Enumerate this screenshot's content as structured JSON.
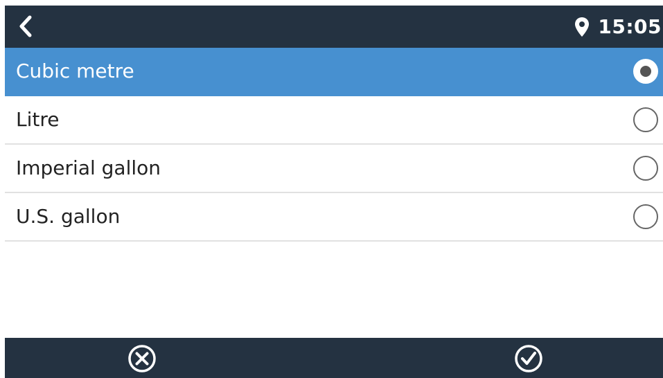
{
  "header": {
    "back_icon": "chevron-left-icon",
    "location_icon": "map-pin-icon",
    "time": "15:05"
  },
  "options": [
    {
      "label": "Cubic metre",
      "selected": true
    },
    {
      "label": "Litre",
      "selected": false
    },
    {
      "label": "Imperial gallon",
      "selected": false
    },
    {
      "label": "U.S. gallon",
      "selected": false
    }
  ],
  "footer": {
    "cancel_icon": "cancel-circle-icon",
    "confirm_icon": "check-circle-icon"
  },
  "colors": {
    "bar_background": "#243241",
    "selected_row": "#4790d0",
    "divider": "#e1e1e1"
  }
}
